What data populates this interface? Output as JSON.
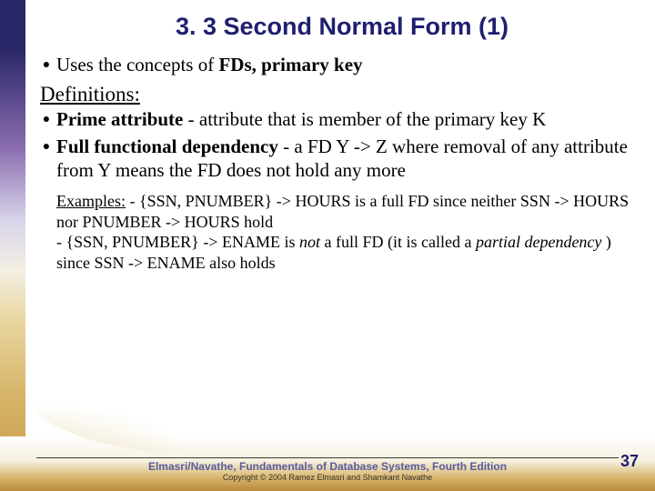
{
  "title": "3. 3 Second Normal Form (1)",
  "intro": {
    "pre": "Uses the concepts of ",
    "bold": "FDs, primary key"
  },
  "definitions_heading": "Definitions:",
  "item1": {
    "term": "Prime attribute",
    "rest": " - attribute that is member of the primary key K"
  },
  "item2": {
    "term": "Full functional dependency",
    "rest": " - a FD  Y -> Z where removal of any attribute from Y means the FD does not hold any more"
  },
  "examples": {
    "label": "Examples:",
    "line1": "    - {SSN, PNUMBER} -> HOURS is a full FD since neither SSN -> HOURS nor PNUMBER -> HOURS hold",
    "line2a": " - {SSN, PNUMBER} -> ENAME is ",
    "line2_not": "not",
    "line2b": "  a full FD (it is called a ",
    "line2_partial": "partial dependency",
    "line2c": " ) since SSN -> ENAME also holds"
  },
  "footer": {
    "title": "Elmasri/Navathe, Fundamentals of Database Systems, Fourth Edition",
    "copyright": "Copyright © 2004 Ramez Elmasri and Shamkant Navathe"
  },
  "page_number": "37"
}
